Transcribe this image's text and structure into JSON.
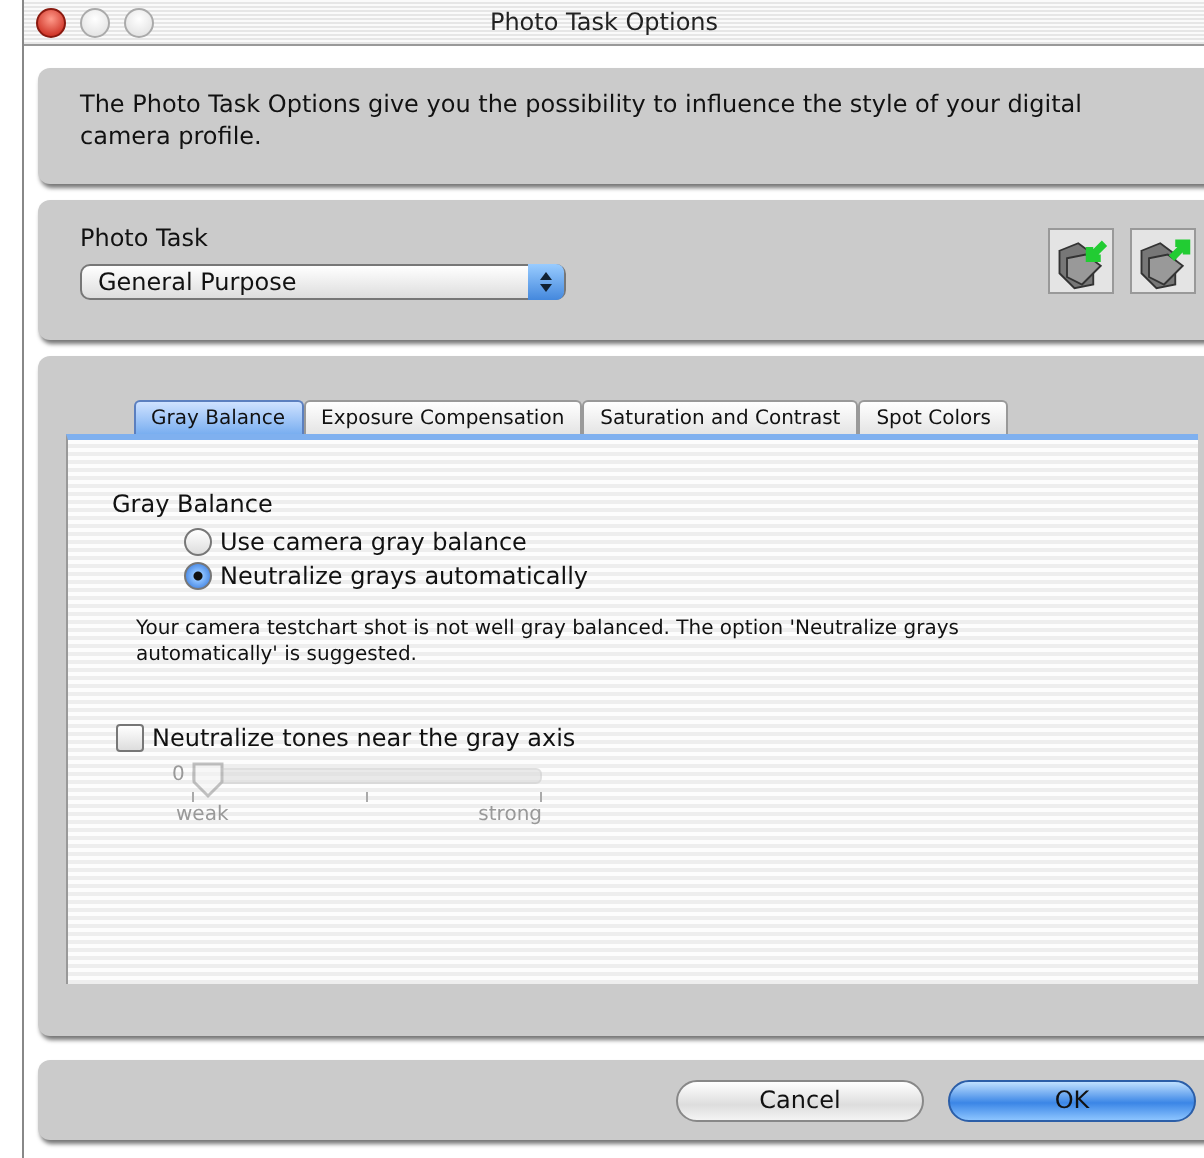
{
  "window": {
    "title": "Photo Task Options"
  },
  "intro": {
    "text": "The Photo Task Options give you the possibility to influence the style of your digital camera profile."
  },
  "photo_task": {
    "label": "Photo Task",
    "popup": {
      "value": "General Purpose"
    }
  },
  "tabs": [
    {
      "label": "Gray Balance",
      "selected": true
    },
    {
      "label": "Exposure Compensation",
      "selected": false
    },
    {
      "label": "Saturation and Contrast",
      "selected": false
    },
    {
      "label": "Spot Colors",
      "selected": false
    }
  ],
  "gray_balance": {
    "heading": "Gray Balance",
    "radios": [
      {
        "label": "Use camera gray balance",
        "selected": false
      },
      {
        "label": "Neutralize grays automatically",
        "selected": true
      }
    ],
    "note": "Your camera testchart shot is not well gray balanced. The option 'Neutralize grays automatically' is suggested.",
    "checkbox": {
      "label": "Neutralize tones near the gray axis",
      "checked": false
    },
    "slider": {
      "value_label": "0",
      "level": 0,
      "disabled": true,
      "min_label": "weak",
      "max_label": "strong"
    }
  },
  "buttons": [
    {
      "label": "Cancel",
      "default": false
    },
    {
      "label": "OK",
      "default": true
    }
  ]
}
